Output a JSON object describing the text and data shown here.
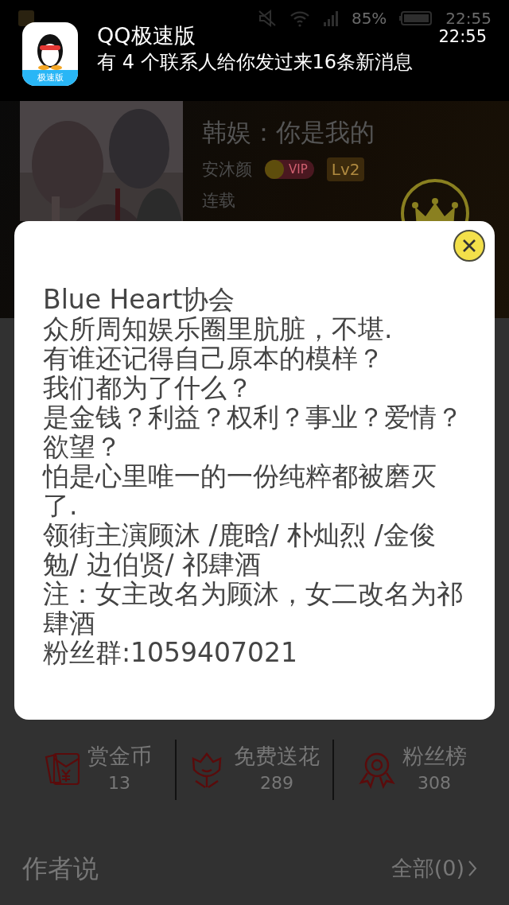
{
  "status_bar": {
    "battery_text": "85%",
    "time": "22:55"
  },
  "notification": {
    "app": "QQ极速版",
    "icon_label": "极速版",
    "time": "22:55",
    "message": "有 4 个联系人给你发过来16条新消息"
  },
  "book": {
    "title": "韩娱：你是我的",
    "author": "安沐颜",
    "vip_label": "VIP",
    "level": "Lv2",
    "status": "连载"
  },
  "dialog": {
    "paragraphs": [
      "Blue Heart协会",
      "众所周知娱乐圈里肮脏，不堪.",
      "有谁还记得自己原本的模样？",
      "我们都为了什么？",
      "是金钱？利益？权利？事业？爱情？欲望？",
      "怕是心里唯一的一份纯粹都被磨灭了.",
      "领街主演顾沐 /鹿晗/ 朴灿烈 /金俊勉/ 边伯贤/ 祁肆酒",
      "注：女主改名为顾沐，女二改名为祁肆酒",
      "粉丝群:1059407021"
    ]
  },
  "stats": [
    {
      "kind": "coin",
      "label": "赏金币",
      "count": "13"
    },
    {
      "kind": "flower",
      "label": "免费送花",
      "count": "289"
    },
    {
      "kind": "fans",
      "label": "粉丝榜",
      "count": "308"
    }
  ],
  "author_notes": {
    "title": "作者说",
    "link": "全部(0)"
  }
}
